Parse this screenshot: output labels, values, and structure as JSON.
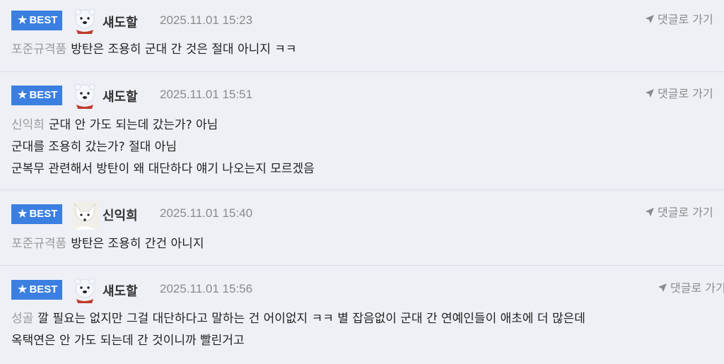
{
  "badge_label": "BEST",
  "reply_label": "댓글로 가기",
  "comments": [
    {
      "author": "섀도할",
      "avatar_icon": "polar-bear-avatar-icon",
      "datetime": "2025.11.01 15:23",
      "mention": "포준규격품",
      "lines": [
        "방탄은 조용히 군대 간 것은 절대 아니지 ㅋㅋ"
      ]
    },
    {
      "author": "섀도할",
      "avatar_icon": "polar-bear-avatar-icon",
      "datetime": "2025.11.01 15:51",
      "mention": "신익희",
      "lines": [
        "군대 안 가도 되는데 갔는가? 아님",
        "군대를 조용히 갔는가? 절대 아님",
        "군복무 관련해서 방탄이 왜 대단하다 얘기 나오는지 모르겠음"
      ]
    },
    {
      "author": "신익희",
      "avatar_icon": "arctic-fox-avatar-icon",
      "datetime": "2025.11.01 15:40",
      "mention": "포준규격품",
      "lines": [
        "방탄은 조용히 간건 아니지"
      ]
    },
    {
      "author": "섀도할",
      "avatar_icon": "polar-bear-avatar-icon",
      "datetime": "2025.11.01 15:56",
      "mention": "성골",
      "lines": [
        "깔 필요는 없지만 그걸 대단하다고 말하는 건 어이없지 ㅋㅋ 별 잡음없이 군대 간 연예인들이 애초에 더 많은데",
        "옥택연은 안 가도 되는데 간 것이니까 빨린거고"
      ]
    }
  ]
}
